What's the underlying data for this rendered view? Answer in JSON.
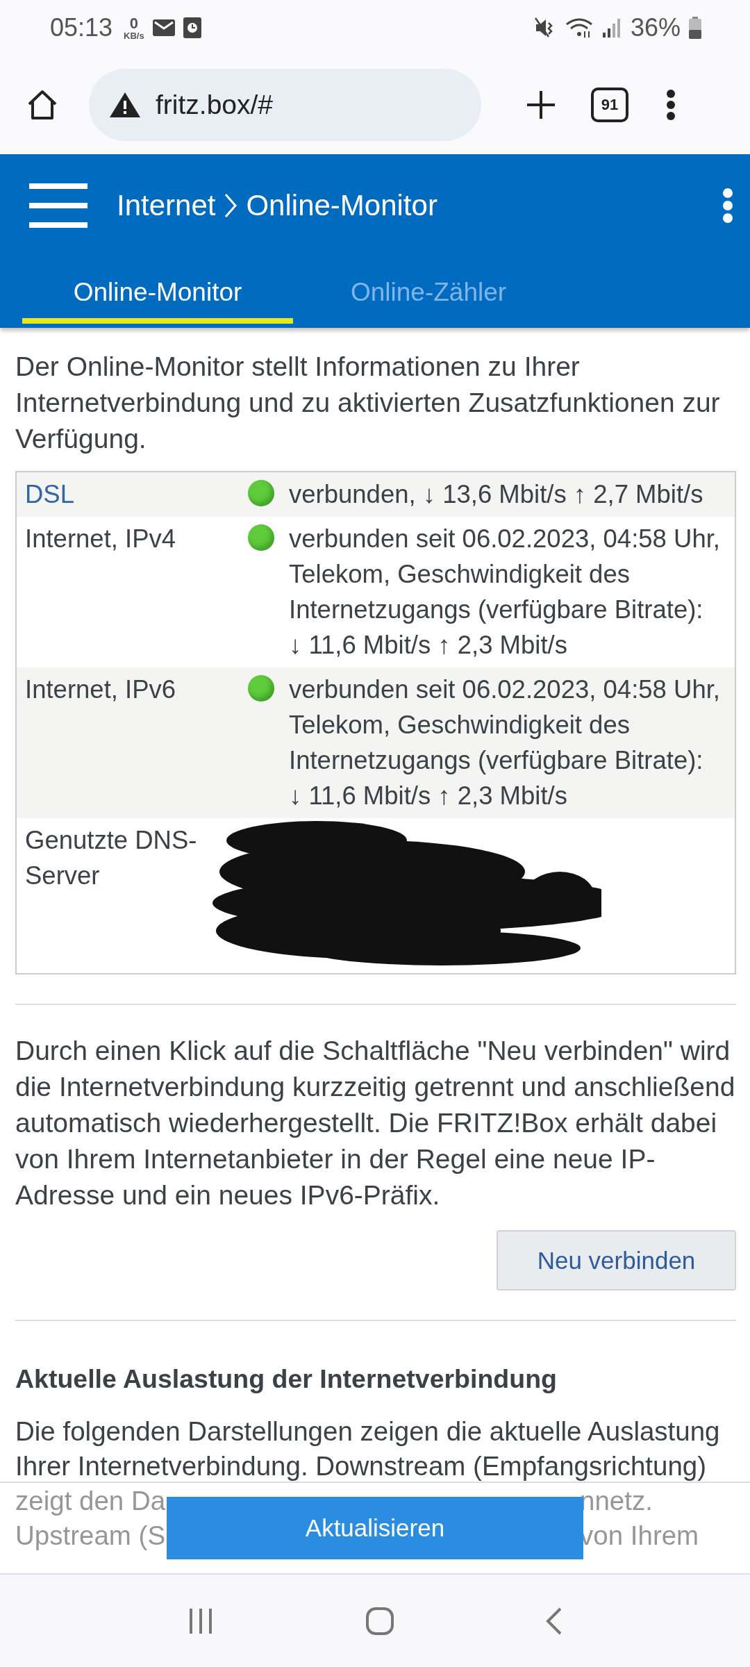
{
  "status_bar": {
    "time": "05:13",
    "net_speed_value": "0",
    "net_speed_unit": "KB/s",
    "battery": "36%"
  },
  "browser": {
    "url": "fritz.box/#",
    "tab_count": "91"
  },
  "header": {
    "breadcrumb": [
      "Internet",
      "Online-Monitor"
    ]
  },
  "tabs": [
    {
      "label": "Online-Monitor",
      "selected": true
    },
    {
      "label": "Online-Zähler",
      "selected": false
    }
  ],
  "intro": "Der Online-Monitor stellt Informationen zu Ihrer Internetverbindung und zu aktivierten Zusatzfunktionen zur Verfügung.",
  "table": {
    "rows": [
      {
        "label": "DSL",
        "kind": "link",
        "color": "#5fcc3c",
        "value_lines": [
          "verbunden, ↓ 13,6 Mbit/s ↑ 2,7 Mbit/s"
        ]
      },
      {
        "label": "Internet, IPv4",
        "kind": "text",
        "color": "#5fcc3c",
        "value_lines": [
          "verbunden seit 06.02.2023, 04:58 Uhr,",
          "Telekom, Geschwindigkeit des",
          "Internetzugangs (verfügbare Bitrate):",
          "↓ 11,6 Mbit/s ↑ 2,3 Mbit/s"
        ]
      },
      {
        "label": "Internet, IPv6",
        "kind": "text",
        "color": "#5fcc3c",
        "value_lines": [
          "verbunden seit 06.02.2023, 04:58 Uhr,",
          "Telekom, Geschwindigkeit des",
          "Internetzugangs (verfügbare Bitrate):",
          "↓ 11,6 Mbit/s ↑ 2,3 Mbit/s"
        ]
      },
      {
        "label": "Genutzte DNS-Server",
        "kind": "text",
        "redacted": true
      }
    ]
  },
  "reconnect": {
    "text": "Durch einen Klick auf die Schaltfläche \"Neu verbinden\" wird die Internetverbindung kurzzeitig getrennt und anschließend automatisch wiederhergestellt. Die FRITZ!Box erhält dabei von Ihrem Internetanbieter in der Regel eine neue IP-Adresse und ein neues IPv6-Präfix.",
    "button": "Neu verbinden"
  },
  "load_section": {
    "heading": "Aktuelle Auslastung der Internetverbindung",
    "lines": [
      [
        "Die folgenden Darstellungen zeigen die aktuelle Auslastung"
      ],
      [
        "Ihrer Internetverbindung. Downstream (Empfangsrichtung)"
      ],
      [
        "zeigt den Da",
        "nnetz."
      ],
      [
        "Upstream (S",
        "von Ihrem"
      ]
    ]
  },
  "footer": {
    "button": "Aktualisieren"
  }
}
